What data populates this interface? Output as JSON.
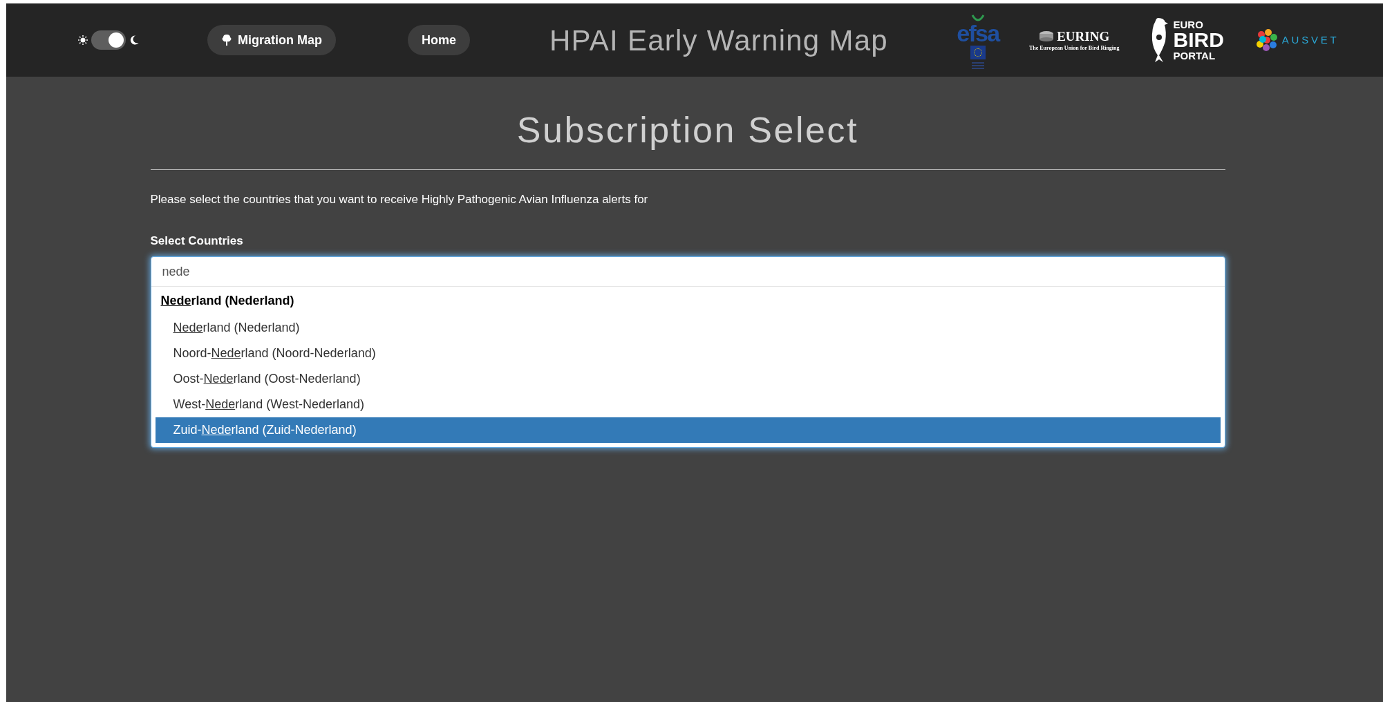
{
  "header": {
    "theme_toggle": {
      "dark": true
    },
    "nav": [
      {
        "label": "Migration Map",
        "kind": "icon"
      },
      {
        "label": "Home",
        "kind": "plain"
      }
    ],
    "title": "HPAI Early Warning Map",
    "logos": [
      {
        "kind": "efsa",
        "text": "efsa"
      },
      {
        "kind": "euring",
        "text": "EURING",
        "subtitle": "The European Union for Bird Ringing"
      },
      {
        "kind": "birdportal",
        "lines": [
          "EURO",
          "BIRD",
          "PORTAL"
        ]
      },
      {
        "kind": "ausvet",
        "text": "AUSVET"
      }
    ]
  },
  "page": {
    "title": "Subscription Select",
    "description": "Please select the countries that you want to receive Highly Pathogenic Avian Influenza alerts for",
    "field_label": "Select Countries",
    "search": {
      "value": "nede"
    },
    "dropdown": {
      "group": {
        "match": "Nede",
        "after": "rland (Nederland)"
      },
      "options": [
        {
          "match": "Nede",
          "after": "rland (Nederland)",
          "selected": false
        },
        {
          "before": "Noord-",
          "match": "Nede",
          "after": "rland (Noord-Nederland)",
          "selected": false
        },
        {
          "before": "Oost-",
          "match": "Nede",
          "after": "rland (Oost-Nederland)",
          "selected": false
        },
        {
          "before": "West-",
          "match": "Nede",
          "after": "rland (West-Nederland)",
          "selected": false
        },
        {
          "before": "Zuid-",
          "match": "Nede",
          "after": "rland (Zuid-Nederland)",
          "selected": true
        }
      ]
    }
  }
}
